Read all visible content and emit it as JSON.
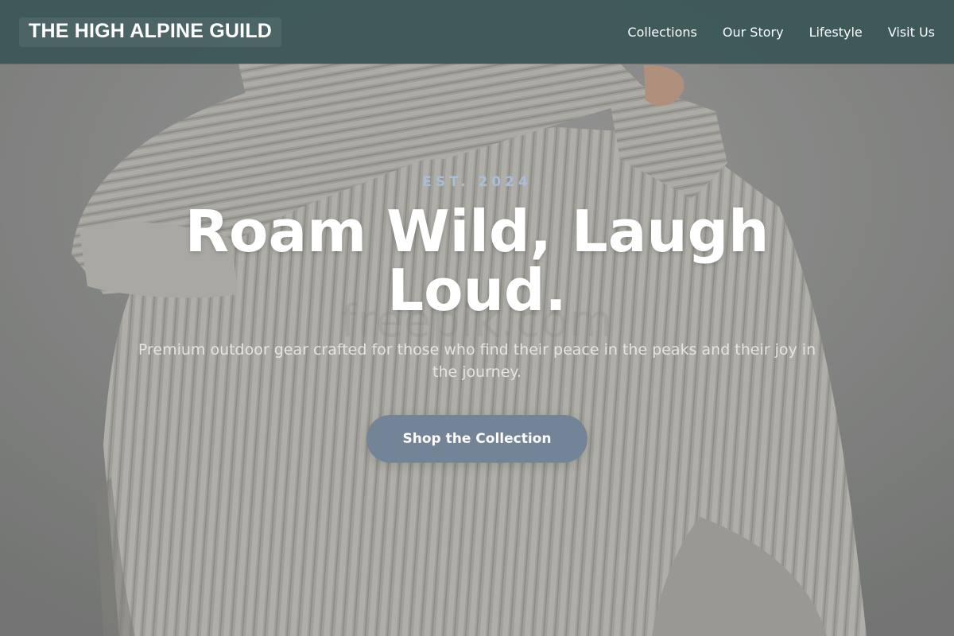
{
  "header": {
    "brand": "THE HIGH ALPINE GUILD",
    "nav": [
      {
        "label": "Collections"
      },
      {
        "label": "Our Story"
      },
      {
        "label": "Lifestyle"
      },
      {
        "label": "Visit Us"
      }
    ]
  },
  "hero": {
    "eyebrow": "EST. 2024",
    "headline": "Roam Wild, Laugh Loud.",
    "subhead": "Premium outdoor gear crafted for those who find their peace in the peaks and their joy in the journey.",
    "cta_label": "Shop the Collection",
    "background_image": "knit-sweater-photo",
    "watermark": "freepik.com"
  },
  "colors": {
    "header_bg": "#3a5658",
    "eyebrow": "#a9bfd9",
    "cta_bg": "#738497",
    "text": "#ffffff"
  }
}
